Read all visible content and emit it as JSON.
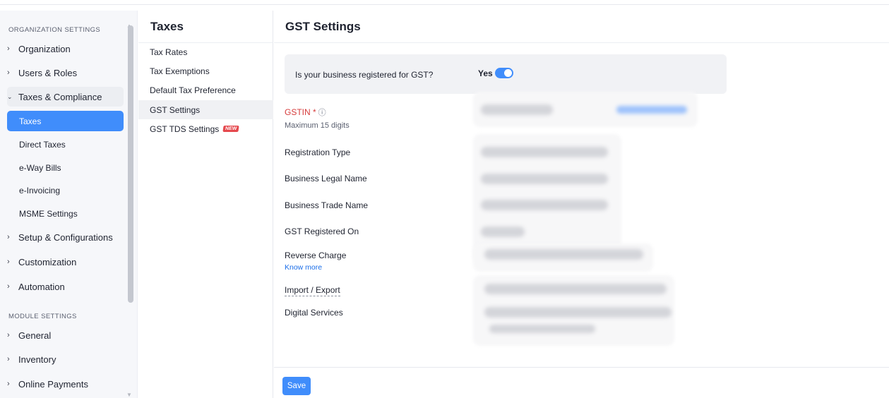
{
  "sidebar": {
    "section_org": "ORGANIZATION SETTINGS",
    "section_module": "MODULE SETTINGS",
    "org_items": [
      {
        "label": "Organization"
      },
      {
        "label": "Users & Roles"
      },
      {
        "label": "Taxes & Compliance",
        "expanded": true
      }
    ],
    "tax_sub_items": [
      {
        "label": "Taxes",
        "active": true
      },
      {
        "label": "Direct Taxes"
      },
      {
        "label": "e-Way Bills"
      },
      {
        "label": "e-Invoicing"
      },
      {
        "label": "MSME Settings"
      }
    ],
    "more_org_items": [
      {
        "label": "Setup & Configurations"
      },
      {
        "label": "Customization"
      },
      {
        "label": "Automation"
      }
    ],
    "module_items": [
      {
        "label": "General"
      },
      {
        "label": "Inventory"
      },
      {
        "label": "Online Payments"
      }
    ]
  },
  "taxes_panel": {
    "title": "Taxes",
    "items": [
      {
        "label": "Tax Rates"
      },
      {
        "label": "Tax Exemptions"
      },
      {
        "label": "Default Tax Preference"
      },
      {
        "label": "GST Settings",
        "active": true
      },
      {
        "label": "GST TDS Settings",
        "badge": "NEW"
      }
    ]
  },
  "main": {
    "title": "GST Settings",
    "gst_question": "Is your business registered for GST?",
    "gst_answer": "Yes",
    "gst_enabled": true,
    "gstin_label": "GSTIN *",
    "gstin_hint": "Maximum 15 digits",
    "registration_type_label": "Registration Type",
    "legal_name_label": "Business Legal Name",
    "trade_name_label": "Business Trade Name",
    "registered_on_label": "GST Registered On",
    "reverse_charge_label": "Reverse Charge",
    "know_more": "Know more",
    "import_export_label": "Import / Export",
    "digital_services_label": "Digital Services",
    "save_label": "Save"
  },
  "colors": {
    "accent": "#408dfb",
    "required": "#d63b3b",
    "link": "#1c6ee8"
  }
}
